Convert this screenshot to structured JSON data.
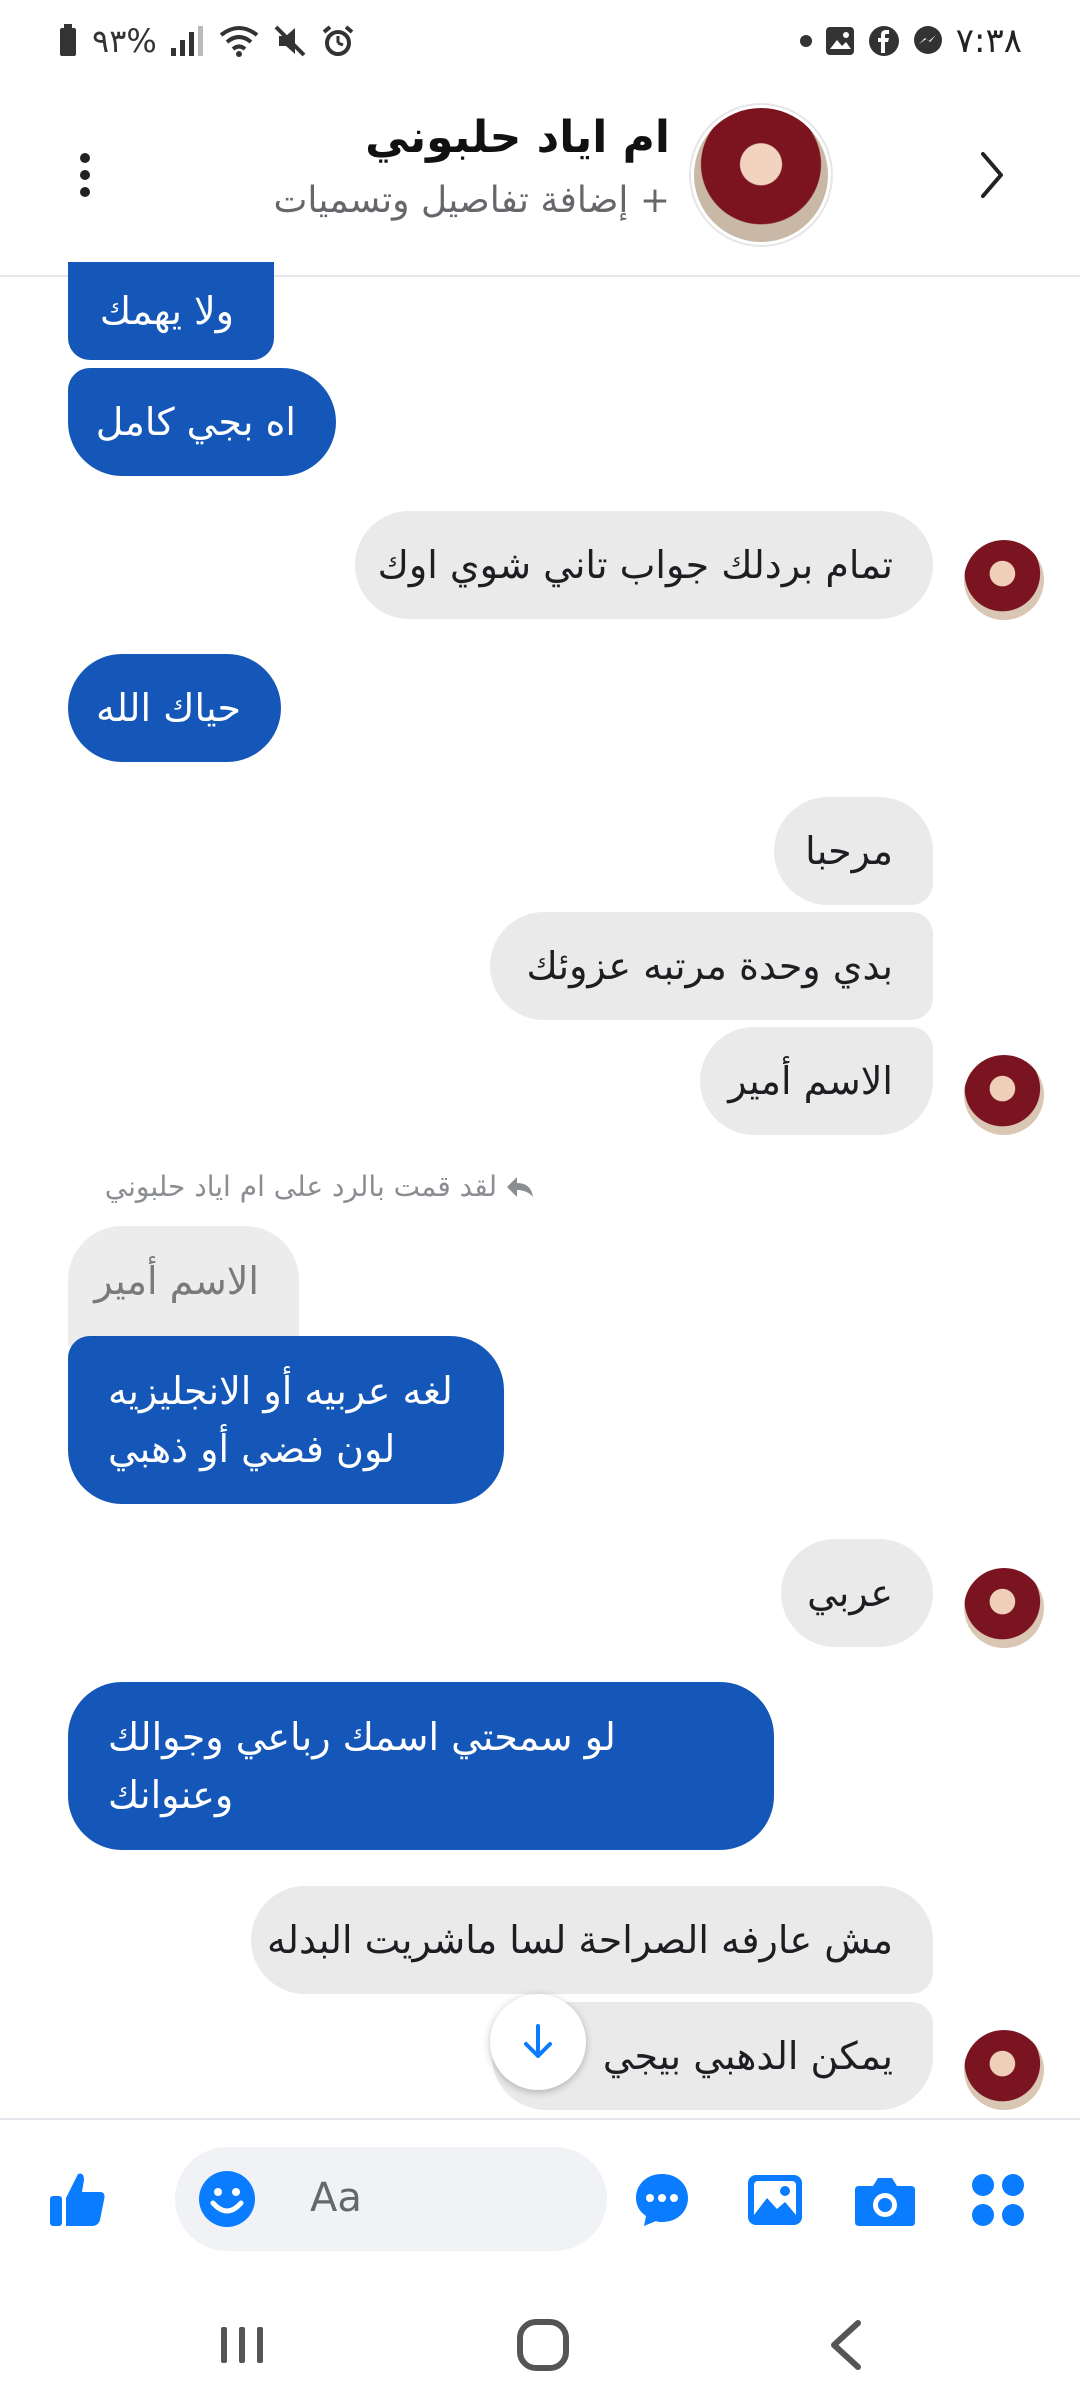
{
  "status_bar": {
    "time": "٧:٣٨",
    "battery": "%٩٣",
    "right_icons": [
      "messenger-icon",
      "facebook-icon",
      "gallery-icon",
      "dot-icon"
    ],
    "left_icons": [
      "alarm-icon",
      "mute-icon",
      "wifi-icon",
      "signal-icon",
      "battery-icon"
    ]
  },
  "header": {
    "contact_name": "ام اياد حلبوني",
    "subtitle": "+ إضافة تفاصيل وتسميات"
  },
  "messages": [
    {
      "text": "ولا يهمك",
      "from": "me"
    },
    {
      "text": "اه بجي كامل",
      "from": "me"
    },
    {
      "text": "تمام بردلك جواب تاني شوي اوك",
      "from": "contact"
    },
    {
      "text": "حياك الله",
      "from": "me"
    },
    {
      "text": "مرحبا",
      "from": "contact"
    },
    {
      "text": "بدي وحدة مرتبه عزوئك",
      "from": "contact"
    },
    {
      "text": "الاسم أمير",
      "from": "contact"
    },
    {
      "text": "الاسم أمير",
      "from": "quoted"
    },
    {
      "line1": "لغه عربيه أو الانجليزيه",
      "line2": "لون فضي أو ذهبي",
      "from": "me"
    },
    {
      "text": "عربي",
      "from": "contact"
    },
    {
      "line1": "لو سمحتي اسمك رباعي وجوالك",
      "line2": "وعنوانك",
      "from": "me"
    },
    {
      "text": "مش عارفه الصراحة لسا ماشريت البدله",
      "from": "contact"
    },
    {
      "text": "يمكن الدهبي بيجي",
      "from": "contact"
    }
  ],
  "reply_label": "لقد قمت بالرد على ام اياد حلبوني",
  "composer": {
    "placeholder": "Aa"
  },
  "colors": {
    "outgoing_bubble": "#1457b8",
    "incoming_bubble": "#eaeaea",
    "accent": "#0a7cff"
  }
}
